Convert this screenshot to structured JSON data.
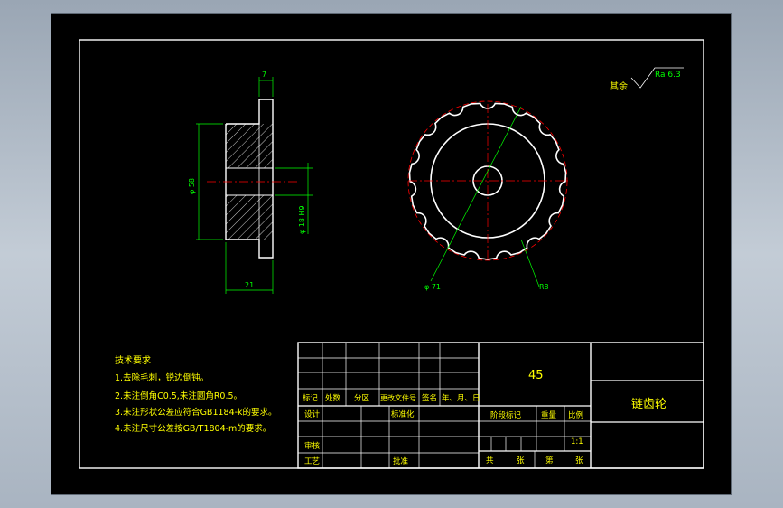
{
  "colors": {
    "background": "#000000",
    "outline": "#ffffff",
    "text": "#ffff00",
    "dimension": "#00ff00",
    "centerline": "#ff0000"
  },
  "drawing": {
    "roughness_prefix": "其余",
    "roughness_value": "Ra 6.3",
    "dim_side_width": "7",
    "dim_left_dia": "φ 58",
    "dim_hub_dia": "φ 18 H9",
    "dim_total_width": "21",
    "dim_outer_dia": "φ 71",
    "dim_tooth_radius": "R8"
  },
  "requirements": {
    "title": "技术要求",
    "items": [
      "1.去除毛刺，锐边倒钝。",
      "2.未注倒角C0.5,未注圆角R0.5。",
      "3.未注形状公差应符合GB1184-k的要求。",
      "4.未注尺寸公差按GB/T1804-m的要求。"
    ]
  },
  "title_block": {
    "material": "45",
    "part_name": "链齿轮",
    "headers": [
      "标记",
      "处数",
      "分区",
      "更改文件号",
      "签名",
      "年、月、日"
    ],
    "row_design": "设计",
    "row_standard": "标准化",
    "row_review": "审核",
    "row_process": "工艺",
    "row_approve": "批准",
    "stage_label": "阶段标记",
    "weight_label": "重量",
    "scale_label": "比例",
    "scale_value": "1:1",
    "sheets": [
      "共",
      "张",
      "第",
      "张"
    ]
  }
}
